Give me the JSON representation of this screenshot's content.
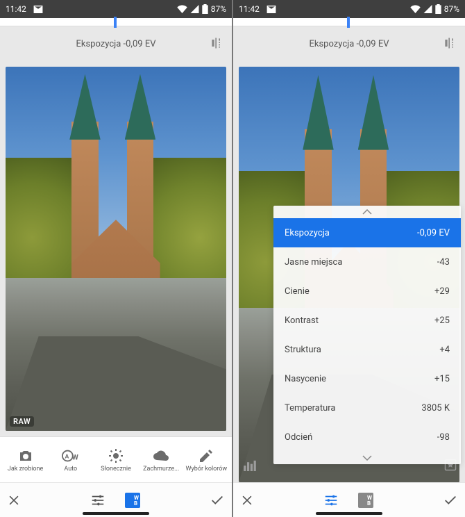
{
  "status": {
    "time": "11:42",
    "battery_pct": "87%"
  },
  "header": {
    "exposure_label_left": "Ekspozycja -0,09 EV",
    "exposure_label_right": "Ekspozycja -0,09 EV"
  },
  "left": {
    "raw_badge": "RAW",
    "wb_options": [
      {
        "key": "jak-zrobione",
        "label": "Jak zrobione"
      },
      {
        "key": "auto",
        "label": "Auto"
      },
      {
        "key": "slonecznie",
        "label": "Słonecznie"
      },
      {
        "key": "zachmurzenie",
        "label": "Zachmurze..."
      },
      {
        "key": "wybor-kolorow",
        "label": "Wybór kolorów"
      }
    ],
    "bottom": {
      "wb_btn_label": "W\nB"
    }
  },
  "right": {
    "panel": [
      {
        "label": "Ekspozycja",
        "value": "-0,09 EV",
        "selected": true
      },
      {
        "label": "Jasne miejsca",
        "value": "-43"
      },
      {
        "label": "Cienie",
        "value": "+29"
      },
      {
        "label": "Kontrast",
        "value": "+25"
      },
      {
        "label": "Struktura",
        "value": "+4"
      },
      {
        "label": "Nasycenie",
        "value": "+15"
      },
      {
        "label": "Temperatura",
        "value": "3805 K"
      },
      {
        "label": "Odcień",
        "value": "-98"
      }
    ],
    "bottom": {
      "wb_btn_label": "W\nB"
    }
  }
}
